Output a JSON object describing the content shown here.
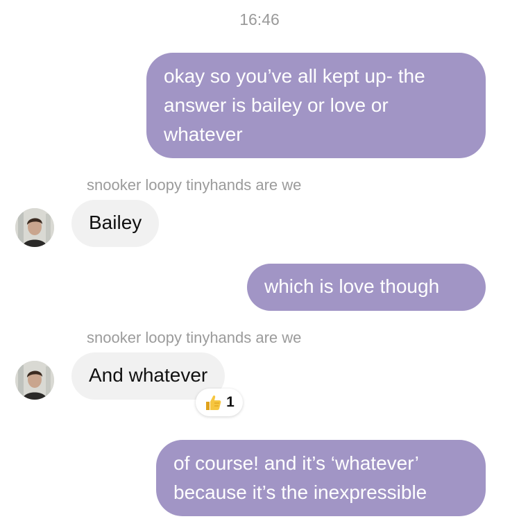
{
  "timestamp": "16:46",
  "messages": [
    {
      "direction": "outgoing",
      "text": "okay so you’ve all kept up- the answer is bailey or love or whatever"
    },
    {
      "direction": "incoming",
      "sender": "snooker loopy tinyhands are we",
      "avatar_icon": "avatar-photo",
      "text": "Bailey"
    },
    {
      "direction": "outgoing",
      "text": "which is love though"
    },
    {
      "direction": "incoming",
      "sender": "snooker loopy tinyhands are we",
      "avatar_icon": "avatar-photo",
      "text": "And whatever",
      "reaction": {
        "icon": "thumbs-up-icon",
        "count": "1"
      }
    },
    {
      "direction": "outgoing",
      "text": "of course! and it’s ‘whatever’ because it’s the inexpressible"
    }
  ],
  "colors": {
    "outgoing_bubble": "#a195c5",
    "incoming_bubble": "#f1f1f1",
    "meta_text": "#9a9a9a"
  }
}
